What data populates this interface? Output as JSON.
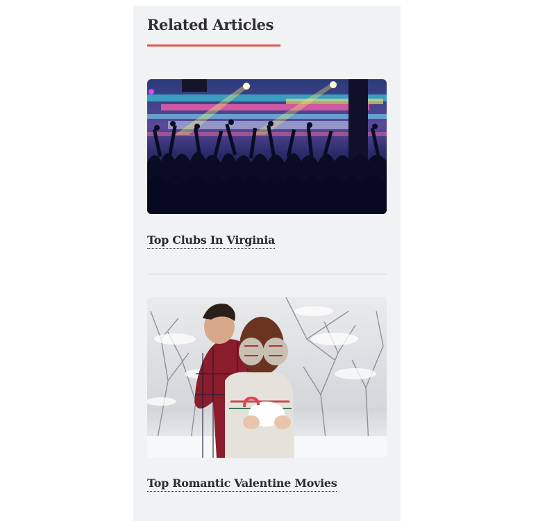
{
  "related": {
    "heading": "Related Articles",
    "accent_color": "#e2574c",
    "articles": [
      {
        "title": "Top Clubs In Virginia",
        "image": "nightclub-crowd-photo"
      },
      {
        "title": "Top Romantic Valentine Movies",
        "image": "couple-in-snow-photo"
      }
    ]
  }
}
